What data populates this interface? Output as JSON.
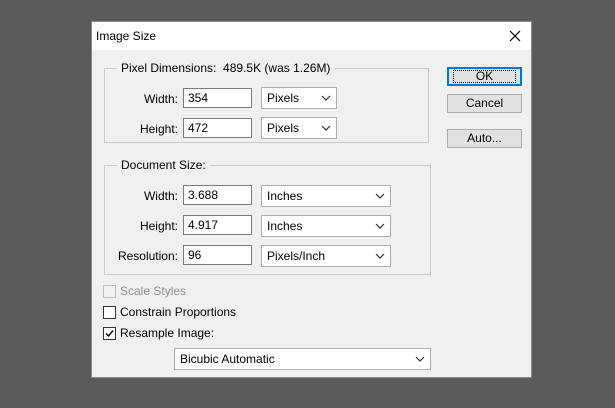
{
  "dialog": {
    "title": "Image Size",
    "pixel_dimensions": {
      "label": "Pixel Dimensions:",
      "value": "489.5K (was 1.26M)",
      "width_label": "Width:",
      "width_value": "354",
      "width_unit": "Pixels",
      "height_label": "Height:",
      "height_value": "472",
      "height_unit": "Pixels"
    },
    "document_size": {
      "label": "Document Size:",
      "width_label": "Width:",
      "width_value": "3.688",
      "width_unit": "Inches",
      "height_label": "Height:",
      "height_value": "4.917",
      "height_unit": "Inches",
      "resolution_label": "Resolution:",
      "resolution_value": "96",
      "resolution_unit": "Pixels/Inch"
    },
    "buttons": {
      "ok": "OK",
      "cancel": "Cancel",
      "auto": "Auto..."
    },
    "options": {
      "scale_styles": {
        "label": "Scale Styles",
        "checked": false,
        "enabled": false
      },
      "constrain_proportions": {
        "label": "Constrain Proportions",
        "checked": false
      },
      "resample_image": {
        "label": "Resample Image:",
        "checked": true
      },
      "resample_method": "Bicubic Automatic"
    }
  },
  "colors": {
    "desktop": "#5b5b5b",
    "dialog_bg": "#f0f0f0",
    "accent": "#0078d7"
  },
  "icons": {
    "close": "close-icon",
    "dropdown": "chevron-down-icon",
    "check": "checkmark-icon"
  }
}
